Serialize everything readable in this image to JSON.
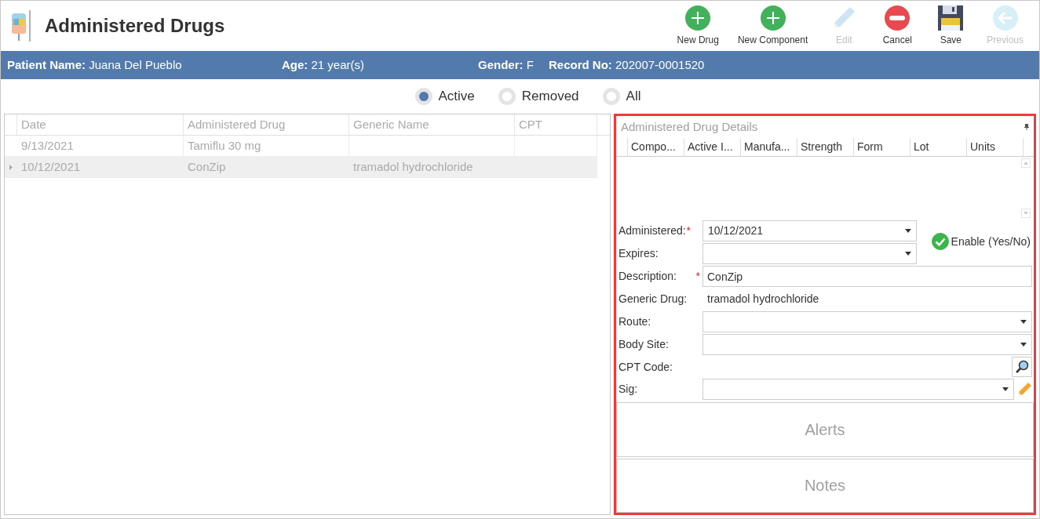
{
  "header": {
    "title": "Administered Drugs"
  },
  "toolbar": [
    {
      "kind": "add",
      "label": "New Drug",
      "disabled": false
    },
    {
      "kind": "add",
      "label": "New Component",
      "disabled": false
    },
    {
      "kind": "edit",
      "label": "Edit",
      "disabled": true
    },
    {
      "kind": "cancel",
      "label": "Cancel",
      "disabled": false
    },
    {
      "kind": "save",
      "label": "Save",
      "disabled": false
    },
    {
      "kind": "back",
      "label": "Previous",
      "disabled": true
    }
  ],
  "patient_bar": [
    {
      "label": "Patient Name:",
      "value": "Juana Del Pueblo"
    },
    {
      "label": "Age:",
      "value": "21 year(s)"
    },
    {
      "label": "Gender:",
      "value": "F"
    },
    {
      "label": "Record No:",
      "value": "202007-0001520"
    }
  ],
  "filters": [
    {
      "label": "Active",
      "selected": true
    },
    {
      "label": "Removed",
      "selected": false
    },
    {
      "label": "All",
      "selected": false
    }
  ],
  "table": {
    "columns": [
      "Date",
      "Administered Drug",
      "Generic Name",
      "CPT"
    ],
    "rows": [
      {
        "cells": [
          "9/13/2021",
          "Tamiflu 30 mg",
          "",
          ""
        ],
        "selected": false
      },
      {
        "cells": [
          "10/12/2021",
          "ConZip",
          "tramadol hydrochloride",
          ""
        ],
        "selected": true
      }
    ]
  },
  "details": {
    "title": "Administered Drug Details",
    "columns": [
      "Compo...",
      "Active I...",
      "Manufa...",
      "Strength",
      "Form",
      "Lot",
      "Units"
    ],
    "fields": [
      {
        "kind": "combo",
        "label": "Administered:",
        "label_mark": "*",
        "value": "10/12/2021"
      },
      {
        "kind": "combo",
        "label": "Expires:"
      },
      {
        "kind": "text",
        "label": "Description:",
        "field_mark": "*",
        "value": "ConZip"
      },
      {
        "kind": "static",
        "label": "Generic Drug:",
        "value": "tramadol hydrochloride"
      },
      {
        "kind": "combo",
        "label": "Route:"
      },
      {
        "kind": "combo",
        "label": "Body Site:"
      },
      {
        "kind": "lookup",
        "label": "CPT Code:"
      },
      {
        "kind": "sig",
        "label": "Sig:"
      }
    ],
    "enable": {
      "label": "Enable (Yes/No)",
      "checked": true
    },
    "sections": [
      "Alerts",
      "Notes"
    ]
  }
}
